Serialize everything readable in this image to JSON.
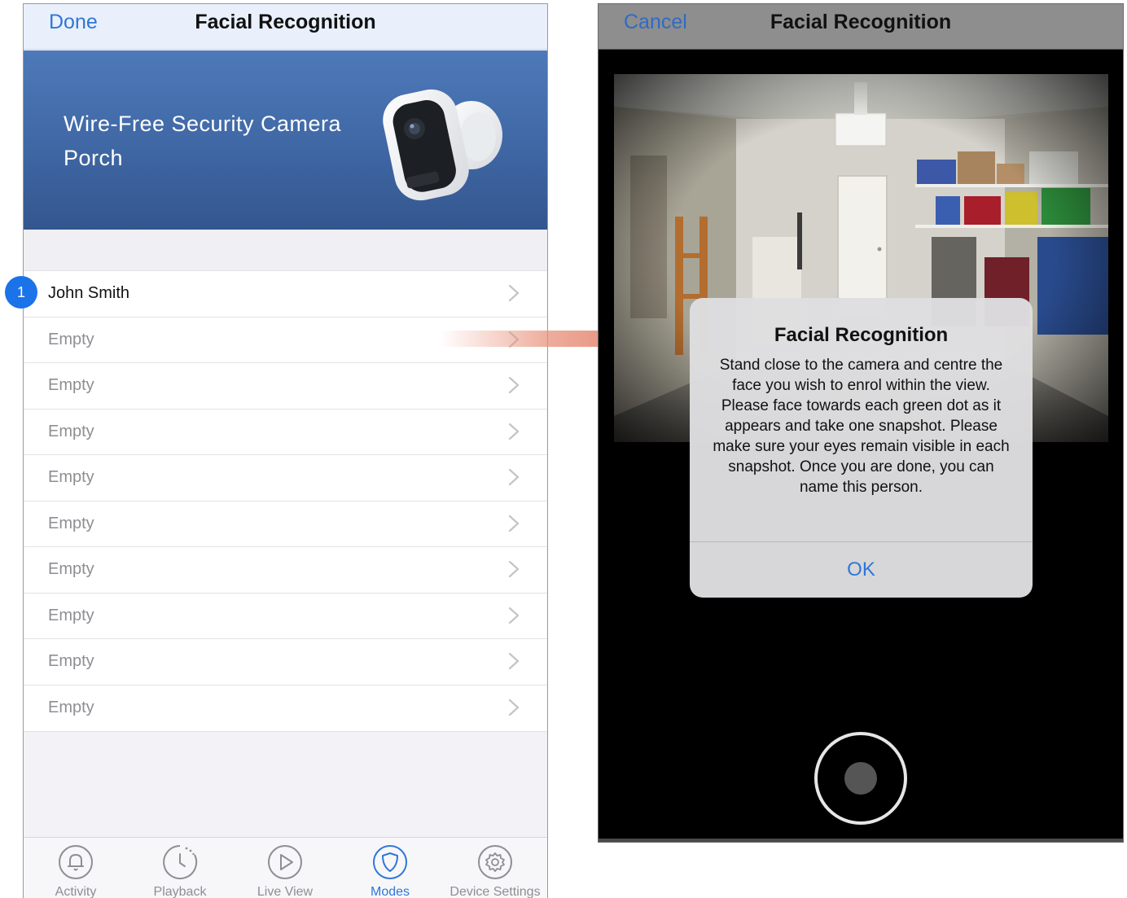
{
  "left": {
    "nav": {
      "done": "Done",
      "title": "Facial Recognition"
    },
    "hero": {
      "line1": "Wire-Free Security Camera",
      "line2": "Porch"
    },
    "badge": "1",
    "rows": [
      {
        "label": "John Smith"
      },
      {
        "label": "Empty"
      },
      {
        "label": "Empty"
      },
      {
        "label": "Empty"
      },
      {
        "label": "Empty"
      },
      {
        "label": "Empty"
      },
      {
        "label": "Empty"
      },
      {
        "label": "Empty"
      },
      {
        "label": "Empty"
      },
      {
        "label": "Empty"
      }
    ],
    "tabs": [
      {
        "label": "Activity",
        "icon": "bell-icon"
      },
      {
        "label": "Playback",
        "icon": "clock-icon"
      },
      {
        "label": "Live View",
        "icon": "play-icon"
      },
      {
        "label": "Modes",
        "icon": "shield-icon",
        "active": true
      },
      {
        "label": "Device Settings",
        "icon": "gear-icon"
      }
    ],
    "colors": {
      "accent": "#2f77d8",
      "hero": "#4a72b0",
      "badge": "#1a73e8"
    }
  },
  "right": {
    "nav": {
      "cancel": "Cancel",
      "title": "Facial Recognition"
    },
    "dialog": {
      "title": "Facial Recognition",
      "message": "Stand close to the camera and centre the face you wish to enrol within the view. Please face towards each green dot as it appears and take one snapshot. Please make sure your eyes remain visible in each snapshot. Once you are done, you can name this person.",
      "ok": "OK"
    }
  }
}
